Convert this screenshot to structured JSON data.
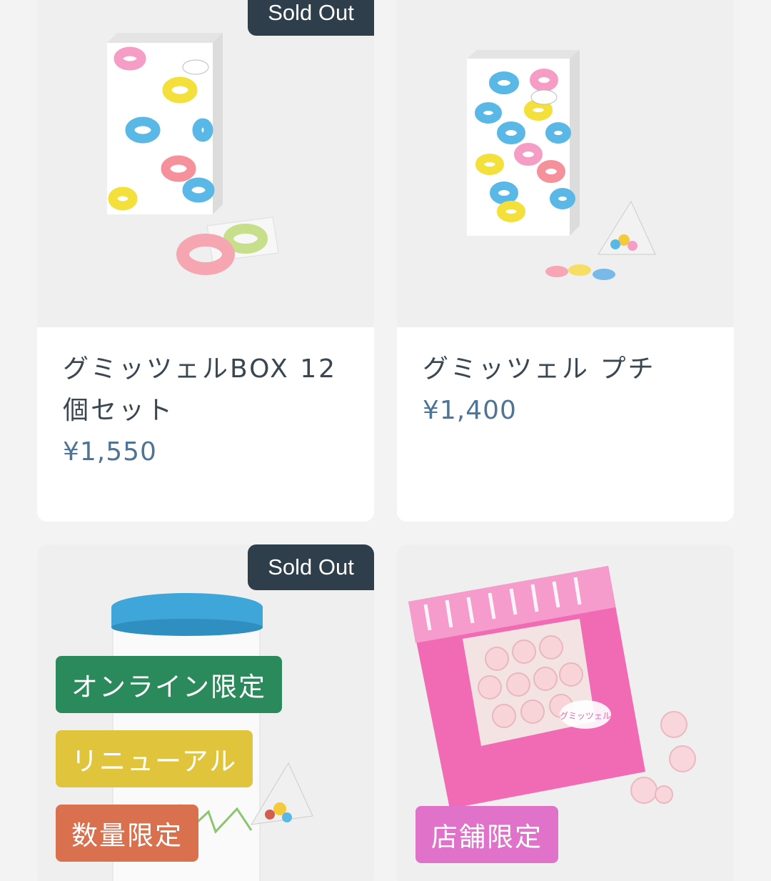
{
  "products": [
    {
      "name": "グミッツェルBOX 12個セット",
      "price": "¥1,550",
      "badge": "Sold Out",
      "tags": []
    },
    {
      "name": "グミッツェル プチ",
      "price": "¥1,400",
      "badge": "",
      "tags": []
    },
    {
      "name": "",
      "price": "",
      "badge": "Sold Out",
      "tags": [
        {
          "label": "オンライン限定",
          "color": "#2b8a5b"
        },
        {
          "label": "リニューアル",
          "color": "#e0c43c"
        },
        {
          "label": "数量限定",
          "color": "#d9714f"
        }
      ]
    },
    {
      "name": "",
      "price": "",
      "badge": "",
      "tags": [
        {
          "label": "店舗限定",
          "color": "#e072c9"
        }
      ]
    }
  ],
  "package_label": "グミッツェル",
  "colors": {
    "price": "#4e7595",
    "name": "#3a4650",
    "sold_out_bg": "#2f3e4b"
  }
}
